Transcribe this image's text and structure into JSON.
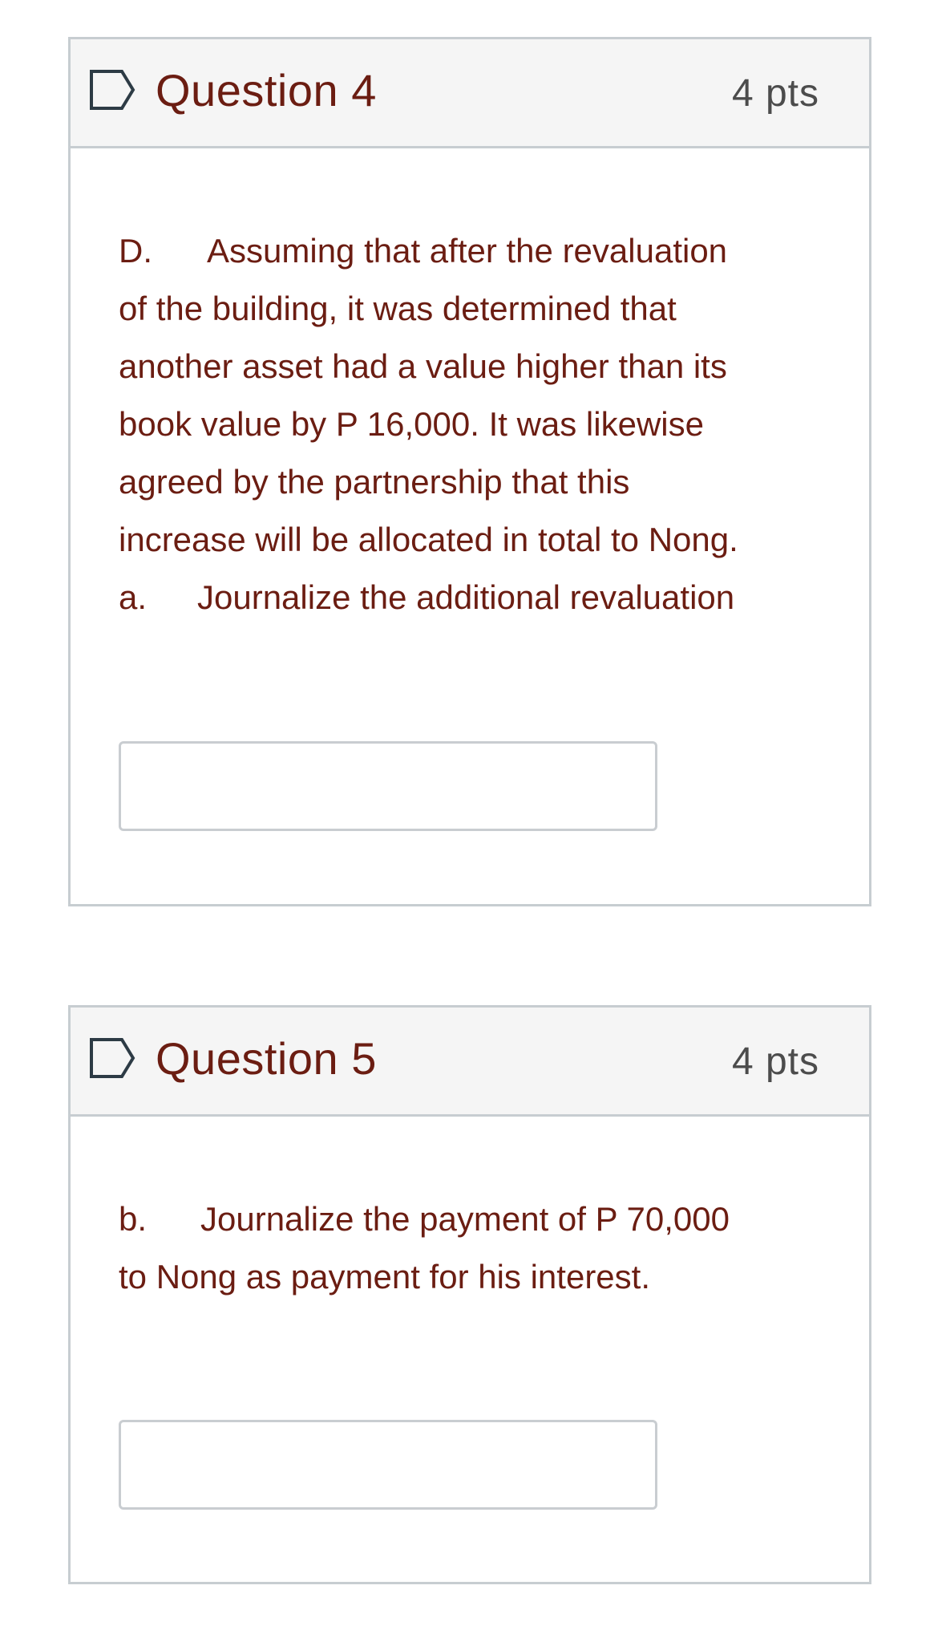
{
  "questions": [
    {
      "title": "Question 4",
      "points": "4 pts",
      "lines": [
        {
          "label": "D.",
          "text": "Assuming that after the revaluation"
        },
        {
          "label": "",
          "text": "of the building, it was determined that"
        },
        {
          "label": "",
          "text": "another asset had a value higher than its"
        },
        {
          "label": "",
          "text": "book value by P 16,000. It was likewise"
        },
        {
          "label": "",
          "text": "agreed by the partnership that this"
        },
        {
          "label": "",
          "text": "increase will be allocated in total to Nong."
        },
        {
          "label": "a.",
          "text": "Journalize the additional revaluation"
        }
      ],
      "answer_value": ""
    },
    {
      "title": "Question 5",
      "points": "4 pts",
      "lines": [
        {
          "label": "b.",
          "text": "Journalize the payment of P 70,000"
        },
        {
          "label": "",
          "text": "to Nong as payment for his interest."
        }
      ],
      "answer_value": ""
    }
  ],
  "colors": {
    "question_text": "#6b1d12",
    "points_text": "#4c4c4c",
    "header_bg": "#f5f5f5",
    "border": "#c7cdd1"
  },
  "icons": {
    "header_flag": "flag-outline-icon"
  }
}
